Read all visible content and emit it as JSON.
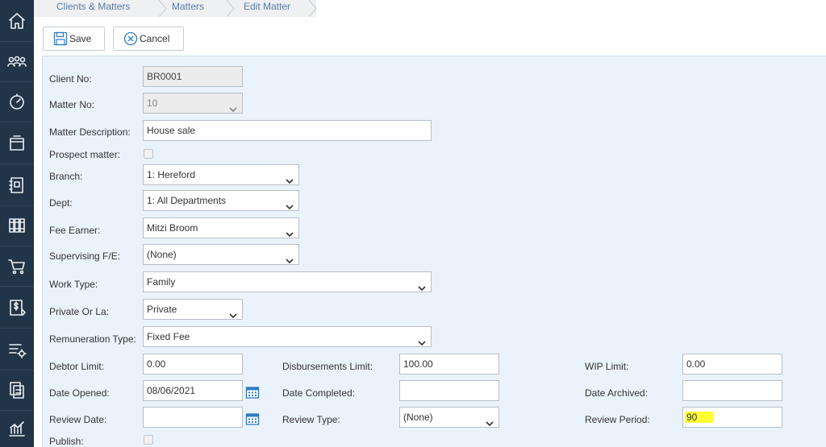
{
  "breadcrumb": {
    "items": [
      {
        "label": "Clients & Matters"
      },
      {
        "label": "Matters"
      },
      {
        "label": "Edit Matter"
      }
    ]
  },
  "toolbar": {
    "save_label": "Save",
    "cancel_label": "Cancel"
  },
  "sidebar": {
    "items": [
      {
        "icon": "home-icon"
      },
      {
        "icon": "people-icon"
      },
      {
        "icon": "dashboard-icon"
      },
      {
        "icon": "archive-box-icon"
      },
      {
        "icon": "notebook-icon"
      },
      {
        "icon": "library-icon"
      },
      {
        "icon": "cart-icon"
      },
      {
        "icon": "billing-icon"
      },
      {
        "icon": "list-settings-icon"
      },
      {
        "icon": "documents-icon"
      },
      {
        "icon": "reports-icon"
      }
    ]
  },
  "form": {
    "client_no": {
      "label": "Client No:",
      "value": "BR0001"
    },
    "matter_no": {
      "label": "Matter No:",
      "value": "10"
    },
    "matter_description": {
      "label": "Matter Description:",
      "value": "House sale"
    },
    "prospect_matter": {
      "label": "Prospect matter:",
      "checked": false
    },
    "branch": {
      "label": "Branch:",
      "value": "1: Hereford"
    },
    "dept": {
      "label": "Dept:",
      "value": "1: All Departments"
    },
    "fee_earner": {
      "label": "Fee Earner:",
      "value": "Mitzi Broom"
    },
    "supervising_fe": {
      "label": "Supervising F/E:",
      "value": "(None)"
    },
    "work_type": {
      "label": "Work Type:",
      "value": "Family"
    },
    "private_or_la": {
      "label": "Private Or La:",
      "value": "Private"
    },
    "remuneration_type": {
      "label": "Remuneration Type:",
      "value": "Fixed Fee"
    },
    "debtor_limit": {
      "label": "Debtor Limit:",
      "value": "0.00"
    },
    "disbursements_limit": {
      "label": "Disbursements Limit:",
      "value": "100.00"
    },
    "wip_limit": {
      "label": "WIP Limit:",
      "value": "0.00"
    },
    "date_opened": {
      "label": "Date Opened:",
      "value": "08/06/2021"
    },
    "date_completed": {
      "label": "Date Completed:",
      "value": ""
    },
    "date_archived": {
      "label": "Date Archived:",
      "value": ""
    },
    "review_date": {
      "label": "Review Date:",
      "value": ""
    },
    "review_type": {
      "label": "Review Type:",
      "value": "(None)"
    },
    "review_period": {
      "label": "Review Period:",
      "value": "90"
    },
    "publish": {
      "label": "Publish:",
      "checked": false
    }
  },
  "colors": {
    "sidebar_bg": "#223447",
    "panel_bg": "#eaf3fb",
    "breadcrumb_text": "#5b7ca6",
    "highlight": "#ffff33",
    "calendar_icon": "#2e7bc4"
  }
}
